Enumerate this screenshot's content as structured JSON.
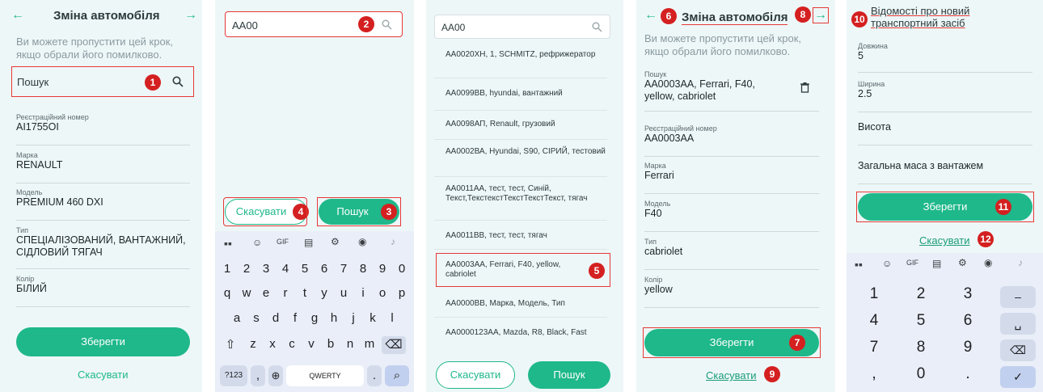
{
  "screen1": {
    "title": "Зміна автомобіля",
    "back_icon": "arrow-left-icon",
    "forward_icon": "arrow-right-icon",
    "hint": "Ви можете пропустити цей крок, якщо обрали його помилково.",
    "search_placeholder": "Пошук",
    "badge": "1",
    "fields": [
      {
        "label": "Реєстраційний номер",
        "value": "АІ1755ОІ"
      },
      {
        "label": "Марка",
        "value": "RENAULT"
      },
      {
        "label": "Модель",
        "value": "PREMIUM 460 DXI"
      },
      {
        "label": "Тип",
        "value": "СПЕЦІАЛІЗОВАНИЙ, ВАНТАЖНИЙ, СІДЛОВИЙ ТЯГАЧ"
      },
      {
        "label": "Колір",
        "value": "БІЛИЙ"
      }
    ],
    "save_label": "Зберегти",
    "cancel_label": "Скасувати"
  },
  "screen2": {
    "search_value": "АА00",
    "badge_search": "2",
    "cancel_label": "Скасувати",
    "badge_cancel": "4",
    "search_button": "Пошук",
    "badge_search_btn": "3",
    "keyboard": {
      "row_numbers": [
        "1",
        "2",
        "3",
        "4",
        "5",
        "6",
        "7",
        "8",
        "9",
        "0"
      ],
      "row1": [
        "q",
        "w",
        "e",
        "r",
        "t",
        "y",
        "u",
        "i",
        "o",
        "p"
      ],
      "row2": [
        "a",
        "s",
        "d",
        "f",
        "g",
        "h",
        "j",
        "k",
        "l"
      ],
      "row3": [
        "z",
        "x",
        "c",
        "v",
        "b",
        "n",
        "m"
      ],
      "sym_label": "?123",
      "comma": ",",
      "space_label": "QWERTY",
      "period": "."
    }
  },
  "screen3": {
    "search_value": "АА00",
    "results": [
      "АА0020ХН, 1, SCHMITZ, рефрижератор",
      "АА0099ВВ, hyundai, вантажний",
      "АА0098АП, Renault, грузовий",
      "АА0002ВА, Hyundai, S90, СІРИЙ, тестовий",
      "АА0011АА, тест, тест, Синій, Текст,ТекстекстТекстТекстТекст, тягач",
      "АА0011ВВ, тест, тест, тягач",
      "АА0003АА, Ferrari, F40, yellow, cabriolet",
      "АА0000ВВ, Марка, Модель, Тип",
      "АА0000123АА, Mazda, R8, Black, Fast"
    ],
    "badge_selected": "5",
    "cancel_label": "Скасувати",
    "search_button": "Пошук"
  },
  "screen4": {
    "title": "Зміна автомобіля",
    "badge_title": "6",
    "badge_forward": "8",
    "hint": "Ви можете пропустити цей крок, якщо обрали його помилково.",
    "search_label": "Пошук",
    "search_value": "АА0003АА, Ferrari, F40, yellow, cabriolet",
    "fields": [
      {
        "label": "Реєстраційний номер",
        "value": "АА0003АА"
      },
      {
        "label": "Марка",
        "value": "Ferrari"
      },
      {
        "label": "Модель",
        "value": "F40"
      },
      {
        "label": "Тип",
        "value": "cabriolet"
      },
      {
        "label": "Колір",
        "value": "yellow"
      }
    ],
    "save_label": "Зберегти",
    "badge_save": "7",
    "cancel_label": "Скасувати",
    "badge_cancel": "9"
  },
  "screen5": {
    "title": "Відомості про новий транспортний засіб",
    "badge_title": "10",
    "fields": [
      {
        "label": "Довжина",
        "value": "5"
      },
      {
        "label": "Ширина",
        "value": "2.5"
      },
      {
        "label": "",
        "value": "Висота"
      },
      {
        "label": "",
        "value": "Загальна маса з вантажем"
      }
    ],
    "save_label": "Зберегти",
    "badge_save": "11",
    "cancel_label": "Скасувати",
    "badge_cancel": "12",
    "numpad": [
      "1",
      "2",
      "3",
      "4",
      "5",
      "6",
      "7",
      "8",
      "9",
      ",",
      "0",
      "."
    ],
    "numpad_side": [
      "–",
      "␣",
      "⌫",
      "✓"
    ]
  },
  "colors": {
    "accent": "#1fb88a",
    "badge": "#d42020",
    "panel_bg": "#eef7f8"
  }
}
